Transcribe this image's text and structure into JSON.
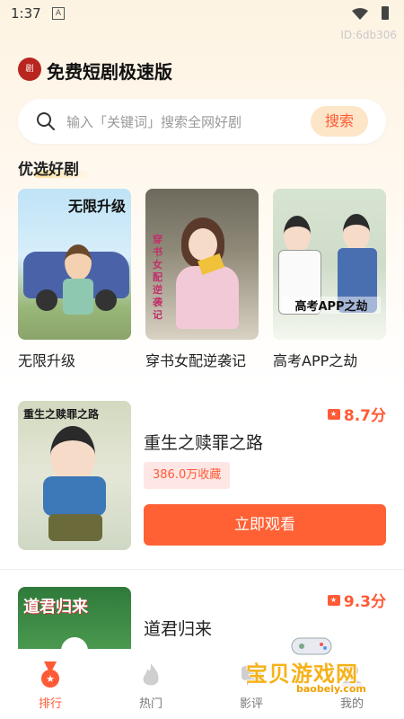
{
  "status_bar": {
    "time": "1:37",
    "sim_label": "A"
  },
  "device_id": "ID:6db306",
  "app": {
    "logo_text": "剧",
    "title": "免费短剧极速版"
  },
  "search": {
    "placeholder": "输入「关键词」搜索全网好剧",
    "button_label": "搜索"
  },
  "featured": {
    "title": "优选好剧",
    "items": [
      {
        "label": "无限升级",
        "poster_text": "无限升级"
      },
      {
        "label": "穿书女配逆袭记",
        "poster_text": "穿书女配逆袭记"
      },
      {
        "label": "高考APP之劫",
        "poster_text": "高考APP之劫"
      }
    ]
  },
  "dramas": [
    {
      "name": "重生之赎罪之路",
      "score": "8.7分",
      "favorites": "386.0万收藏",
      "watch_label": "立即观看",
      "poster_text": "重生之赎罪之路"
    },
    {
      "name": "道君归来",
      "score": "9.3分",
      "poster_text": "道君归来"
    }
  ],
  "tabs": [
    {
      "label": "排行",
      "icon": "medal-icon",
      "active": true
    },
    {
      "label": "热门",
      "icon": "flame-icon",
      "active": false
    },
    {
      "label": "影评",
      "icon": "comment-icon",
      "active": false
    },
    {
      "label": "我的",
      "icon": "user-icon",
      "active": false
    }
  ],
  "watermark": {
    "main": "宝贝游戏网",
    "sub": "baobeiy.com"
  },
  "colors": {
    "accent": "#ff5a36",
    "button": "#ff6134",
    "search_btn_bg": "#fde5c7",
    "tag_bg": "#fde6e4"
  }
}
